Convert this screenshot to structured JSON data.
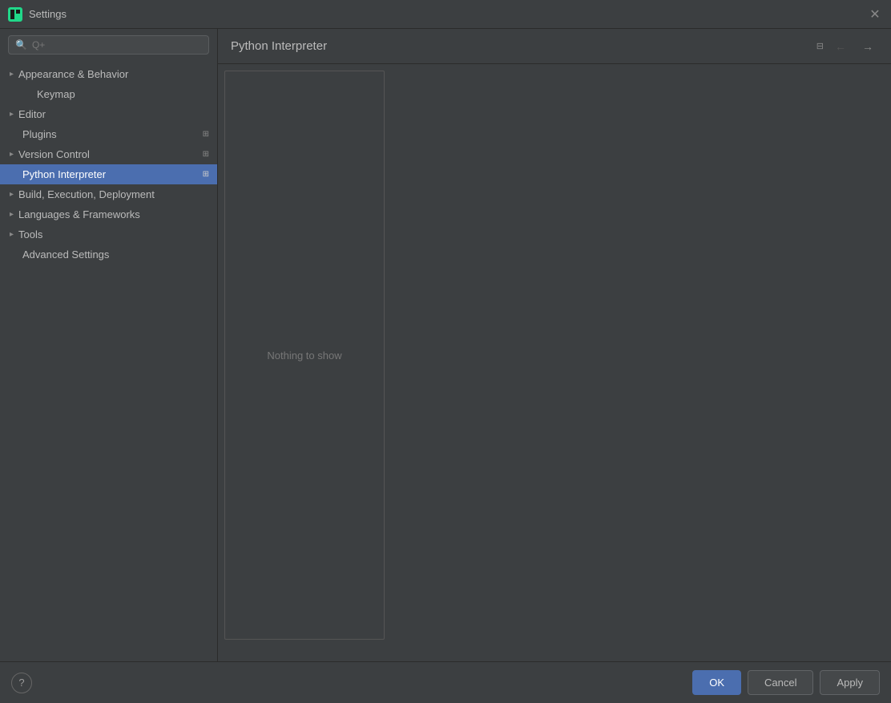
{
  "titleBar": {
    "title": "Settings",
    "appIcon": "pycharm-icon"
  },
  "sidebar": {
    "searchPlaceholder": "Q+",
    "items": [
      {
        "id": "appearance-behavior",
        "label": "Appearance & Behavior",
        "hasChevron": true,
        "isExpanded": true,
        "indent": 0,
        "badge": ""
      },
      {
        "id": "keymap",
        "label": "Keymap",
        "hasChevron": false,
        "indent": 1,
        "badge": ""
      },
      {
        "id": "editor",
        "label": "Editor",
        "hasChevron": true,
        "indent": 0,
        "badge": ""
      },
      {
        "id": "plugins",
        "label": "Plugins",
        "hasChevron": false,
        "indent": 0,
        "badge": "⊞"
      },
      {
        "id": "version-control",
        "label": "Version Control",
        "hasChevron": true,
        "indent": 0,
        "badge": "⊞"
      },
      {
        "id": "python-interpreter",
        "label": "Python Interpreter",
        "hasChevron": false,
        "indent": 0,
        "badge": "⊞",
        "active": true
      },
      {
        "id": "build-execution-deployment",
        "label": "Build, Execution, Deployment",
        "hasChevron": true,
        "indent": 0,
        "badge": ""
      },
      {
        "id": "languages-frameworks",
        "label": "Languages & Frameworks",
        "hasChevron": true,
        "indent": 0,
        "badge": ""
      },
      {
        "id": "tools",
        "label": "Tools",
        "hasChevron": true,
        "indent": 0,
        "badge": ""
      },
      {
        "id": "advanced-settings",
        "label": "Advanced Settings",
        "hasChevron": false,
        "indent": 0,
        "badge": ""
      }
    ]
  },
  "contentHeader": {
    "title": "Python Interpreter",
    "badge": "⊟"
  },
  "contentBody": {
    "nothingToShow": "Nothing to show"
  },
  "bottomBar": {
    "helpLabel": "?",
    "okLabel": "OK",
    "cancelLabel": "Cancel",
    "applyLabel": "Apply"
  }
}
